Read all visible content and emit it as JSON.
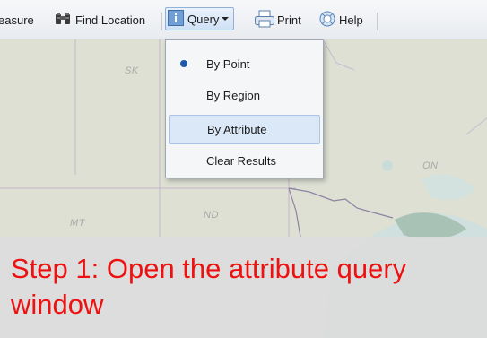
{
  "toolbar": {
    "measure_label": "easure",
    "find_location_label": "Find Location",
    "query_label": "Query",
    "print_label": "Print",
    "help_label": "Help"
  },
  "query_menu": {
    "items": [
      {
        "label": "By Point",
        "selected": true
      },
      {
        "label": "By Region",
        "selected": false
      },
      {
        "label": "By Attribute",
        "selected": false,
        "hovered": true
      },
      {
        "label": "Clear Results",
        "selected": false
      }
    ]
  },
  "map": {
    "labels": [
      "SK",
      "ON",
      "MT",
      "ND"
    ]
  },
  "caption": {
    "text": "Step 1: Open the attribute query window",
    "color": "#ee1111"
  },
  "colors": {
    "accent": "#1e5aa8",
    "hover_bg": "#dbe8f8"
  },
  "icons": [
    "binoculars-icon",
    "info-icon",
    "printer-icon",
    "help-icon"
  ]
}
